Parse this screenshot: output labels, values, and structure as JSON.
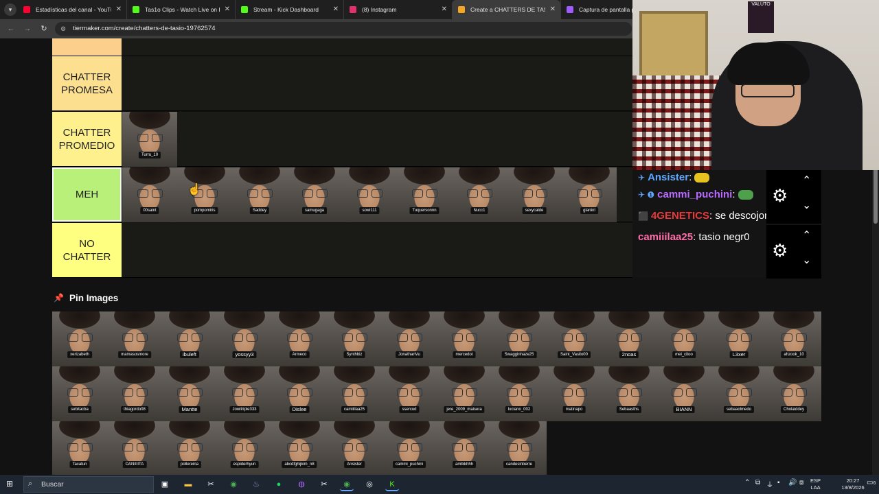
{
  "browser": {
    "tabs": [
      {
        "label": "Estadísticas del canal - YouTube",
        "color": "#ff0033",
        "active": false
      },
      {
        "label": "Tas1o Clips - Watch Live on Kick",
        "color": "#53fc18",
        "active": false
      },
      {
        "label": "Stream - Kick Dashboard",
        "color": "#53fc18",
        "active": false
      },
      {
        "label": "(8) Instagram",
        "color": "#e1306c",
        "active": false
      },
      {
        "label": "Create a CHATTERS DE TASIO T",
        "color": "#f5a623",
        "active": true
      },
      {
        "label": "Captura de pantalla po",
        "color": "#a05cff",
        "active": false
      }
    ],
    "url": "tiermaker.com/create/chatters-de-tasio-19762574"
  },
  "tiers": [
    {
      "label": "",
      "color": "#fcd08c",
      "items": []
    },
    {
      "label": "CHATTER\nPROMESA",
      "color": "#fcdf8f",
      "items": []
    },
    {
      "label": "CHATTER\nPROMEDIO",
      "color": "#fef08d",
      "items": [
        "Turru_10"
      ]
    },
    {
      "label": "MEH",
      "color": "#b9f07a",
      "items": [
        "00saint",
        "pompomiris",
        "Saddey",
        "samugaga",
        "sowi111",
        "Tuquersonnn",
        "Nucc1",
        "sexycalde",
        "glankri"
      ]
    },
    {
      "label": "NO\nCHATTER",
      "color": "#fefe80",
      "items": []
    }
  ],
  "pin_images": {
    "label": "Pin Images"
  },
  "pool": [
    "xerizabeth",
    "mamasosmore",
    "ibuleft",
    "yossyy3",
    "Armeco",
    "Synthbiz",
    "JonathanVu",
    "mercedot",
    "Swagginhaze25",
    "Saint_Vasito00",
    "2noas",
    "mei_citoo",
    "L3xer",
    "ahzook_10",
    "sebitacba",
    "thiagordo08",
    "Mantte",
    "Jowitriple333",
    "Dislee",
    "camiiilaa25",
    "ssercud",
    "jere_2009_maisera",
    "luciano_002",
    "matinapo",
    "Sebaasths",
    "BIANN",
    "sebaaolmedo",
    "Cholaiddey",
    "Tacatun",
    "DANIIIITA",
    "pollereina",
    "espiderhyun",
    "abcdfghijkim_n8",
    "Ansister",
    "cammi_puchini",
    "ambikhhh",
    "candesinberre"
  ],
  "overlay": {
    "poster_text": "VALUTO",
    "chat": [
      {
        "user": "Ansister",
        "message": "",
        "user_color": "blue",
        "badge": "✈"
      },
      {
        "user": "cammi_puchini",
        "message": "",
        "user_color": "purple",
        "badge": "✈ ❶"
      },
      {
        "user": "4GENETICS",
        "message": "se descojona",
        "user_color": "red",
        "badge": "⬛"
      },
      {
        "user": "camiiilaa25",
        "message": "tasio negr0",
        "user_color": "pink",
        "badge": ""
      }
    ]
  },
  "taskbar": {
    "search_placeholder": "Buscar",
    "lang_line1": "ESP",
    "lang_line2": "LAA",
    "time": "20:27",
    "date": "13/8/2026",
    "notifications": "6"
  }
}
